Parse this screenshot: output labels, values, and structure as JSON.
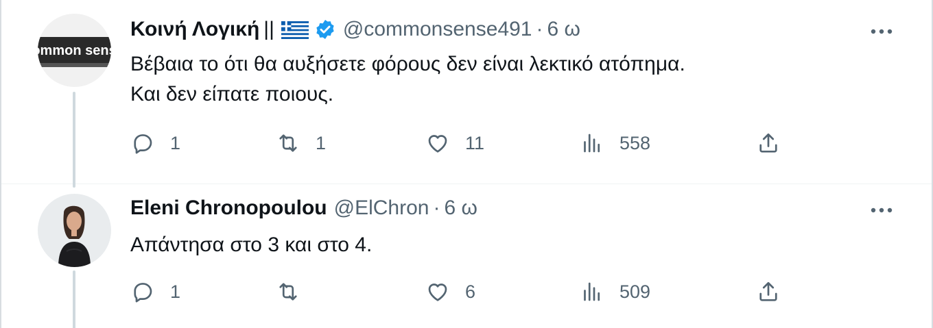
{
  "tweets": [
    {
      "name": "Κοινή Λογική",
      "name_suffix": "||",
      "handle": "@commonsense491",
      "separator": "·",
      "time": "6 ω",
      "avatar_text": "common sense",
      "text_lines": [
        "Βέβαια το ότι θα αυξήσετε φόρους δεν είναι λεκτικό ατόπημα.",
        "Και δεν είπατε ποιους."
      ],
      "replies": "1",
      "retweets": "1",
      "likes": "11",
      "views": "558"
    },
    {
      "name": "Eleni Chronopoulou",
      "handle": "@ElChron",
      "separator": "·",
      "time": "6 ω",
      "text_lines": [
        "Απάντησα στο 3 και στο 4."
      ],
      "replies": "1",
      "retweets": "",
      "likes": "6",
      "views": "509"
    }
  ],
  "icons": {
    "reply": "reply-icon",
    "retweet": "retweet-icon",
    "like": "heart-icon",
    "views": "views-icon",
    "share": "share-icon",
    "more": "more-icon",
    "verified": "verified-badge-icon",
    "flag": "greek-flag-icon"
  },
  "colors": {
    "text": "#0f1419",
    "secondary": "#536471",
    "verified": "#1d9bf0",
    "thread_line": "#cfd9de"
  }
}
